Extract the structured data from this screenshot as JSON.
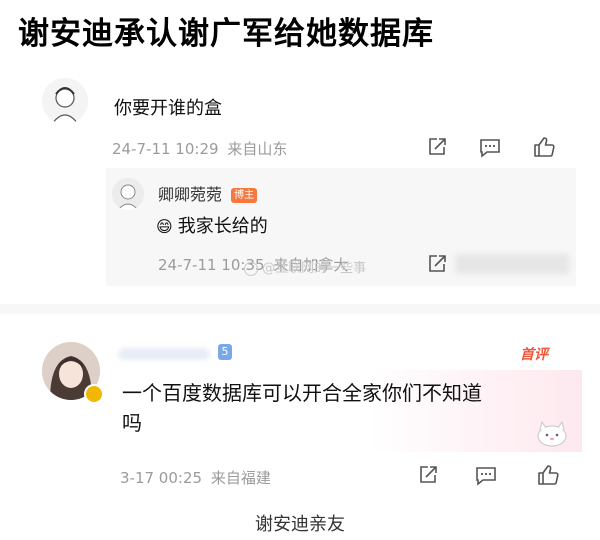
{
  "headline": "谢安迪承认谢广军给她数据库",
  "comment1": {
    "text": "你要开谁的盒",
    "time": "24-7-11 10:29",
    "location": "来自山东"
  },
  "reply": {
    "username": "卿卿菀菀",
    "badge": "博主",
    "emoji": "😄",
    "text": "我家长给的",
    "time": "24-7-11 10:35",
    "location": "来自加拿大",
    "watermark": "@互联网的一些事"
  },
  "comment2": {
    "level": "5",
    "tag": "首评",
    "text_line1": "一个百度数据库可以开合全家你们不知道",
    "text_line2": "吗",
    "time": "3-17 00:25",
    "location": "来自福建"
  },
  "caption": "谢安迪亲友",
  "colors": {
    "accent_tag": "#f0573c",
    "meta_gray": "#9b9b9b",
    "level_blue": "#7aa7e8"
  },
  "icons": [
    "share-icon",
    "comment-icon",
    "like-icon"
  ]
}
